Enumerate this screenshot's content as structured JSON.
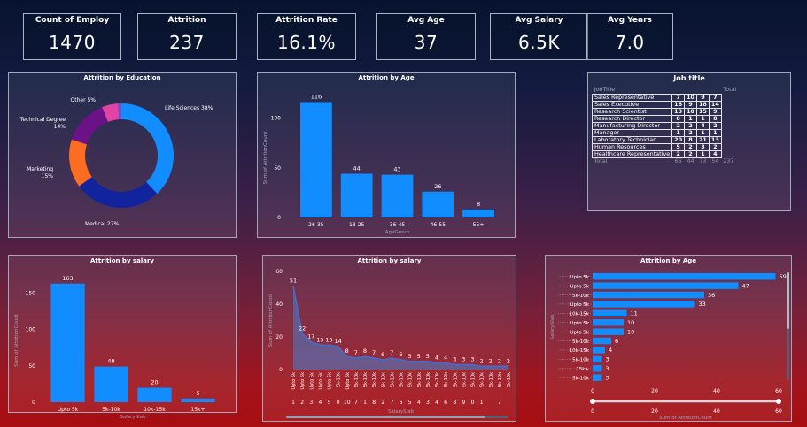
{
  "kpis": [
    {
      "title": "Count of Employ",
      "value": "1470"
    },
    {
      "title": "Attrition",
      "value": "237"
    },
    {
      "title": "Attrition Rate",
      "value": "16.1%"
    },
    {
      "title": "Avg Age",
      "value": "37"
    },
    {
      "title": "Avg Salary",
      "value": "6.5K"
    },
    {
      "title": "Avg Years",
      "value": "7.0"
    }
  ],
  "edu": {
    "title": "Attrition by Education",
    "slices": [
      {
        "label": "Life Sciences 38%",
        "value": 38,
        "color": "#118dff"
      },
      {
        "label": "Medical 27%",
        "value": 27,
        "color": "#12239e"
      },
      {
        "label": "Marketing 15%",
        "value": 15,
        "color": "#fc6c21"
      },
      {
        "label": "Technical Degree 14%",
        "value": 14,
        "color": "#6c1287"
      },
      {
        "label": "Other 5%",
        "value": 5,
        "color": "#e044a7"
      },
      {
        "label": "",
        "value": 1,
        "color": "#744ec2"
      }
    ]
  },
  "age_panel": {
    "title": "Attrition by Age",
    "ylabel": "Sum of AttritionCount",
    "xlabel": "AgeGroup"
  },
  "job": {
    "title": "Job title",
    "headers": [
      "JobTitle",
      "",
      "",
      "",
      "",
      "Total"
    ],
    "rows": [
      {
        "name": "Sales Representative",
        "vals": [
          "7",
          "10",
          "9",
          "7"
        ]
      },
      {
        "name": "Sales Executive",
        "vals": [
          "16",
          "9",
          "18",
          "14"
        ]
      },
      {
        "name": "Research Scientist",
        "vals": [
          "13",
          "10",
          "15",
          "9"
        ]
      },
      {
        "name": "Research Director",
        "vals": [
          "0",
          "1",
          "1",
          "0"
        ]
      },
      {
        "name": "Manufacturing Director",
        "vals": [
          "2",
          "2",
          "4",
          "2"
        ]
      },
      {
        "name": "Manager",
        "vals": [
          "1",
          "2",
          "1",
          "1"
        ]
      },
      {
        "name": "Laboratory Technician",
        "vals": [
          "20",
          "8",
          "21",
          "13"
        ]
      },
      {
        "name": "Human Resources",
        "vals": [
          "5",
          "2",
          "3",
          "2"
        ]
      },
      {
        "name": "Healthcare Representative",
        "vals": [
          "2",
          "2",
          "1",
          "4"
        ]
      }
    ],
    "total_row": {
      "name": "Total",
      "vals": [
        "66",
        "44",
        "73",
        "54"
      ],
      "total": "237"
    }
  },
  "salary_panel": {
    "title": "Attrition by salary",
    "ylabel": "Sum of AttritionCount",
    "xlabel": "SalarySlab"
  },
  "area_panel": {
    "title": "Attrition by salary",
    "ylabel": "Sum of AttritionCount",
    "xlabel": "SalarySlab"
  },
  "hbar_panel": {
    "title": "Attrition by Age",
    "ylabel": "SalarySlab",
    "xlabel": "Sum of AttritionCount"
  },
  "chart_data": [
    {
      "type": "bar",
      "title": "Attrition by Age",
      "xlabel": "AgeGroup",
      "ylabel": "Sum of AttritionCount",
      "categories": [
        "26-35",
        "18-25",
        "36-45",
        "46-55",
        "55+"
      ],
      "values": [
        116,
        44,
        43,
        26,
        8
      ],
      "ylim": [
        0,
        120
      ],
      "yticks": [
        0,
        50,
        100
      ],
      "color": "#118dff"
    },
    {
      "type": "bar",
      "title": "Attrition by salary",
      "xlabel": "SalarySlab",
      "ylabel": "Sum of AttritionCount",
      "categories": [
        "Upto 5k",
        "5k-10k",
        "10k-15k",
        "15k+"
      ],
      "values": [
        163,
        49,
        20,
        5
      ],
      "ylim": [
        0,
        170
      ],
      "yticks": [
        0,
        50,
        100,
        150
      ],
      "color": "#118dff"
    },
    {
      "type": "area",
      "title": "Attrition by salary",
      "xlabel": "SalarySlab",
      "ylabel": "Sum of AttritionCount",
      "categories": [
        "Upto 5k",
        "Upto 5k",
        "Upto 5k",
        "Upto 5k",
        "Upto 5k",
        "5k-10k",
        "Upto 5k",
        "5k-10k",
        "5k-10k",
        "5k-10k",
        "5k-10k",
        "5k-10k",
        "5k-10k",
        "5k-10k",
        "5k-10k",
        "5k-10k",
        "5k-10k",
        "5k-10k",
        "5k-10k",
        "5k-10k",
        "5k-10k",
        "5k-10k",
        "5k-10k",
        "5k-10k",
        "5k-10k"
      ],
      "index_labels": [
        "1",
        "2",
        "3",
        "4",
        "5",
        "0",
        "10",
        "7",
        "1",
        "8",
        "2",
        "7",
        "6",
        "5",
        "4",
        "3",
        "4",
        "6",
        "8",
        "9",
        "0",
        "1",
        "",
        "7",
        ""
      ],
      "values": [
        51,
        22,
        17,
        15,
        15,
        14,
        8,
        7,
        8,
        7,
        6,
        7,
        6,
        5,
        5,
        5,
        4,
        4,
        3,
        3,
        3,
        2,
        2,
        2,
        2
      ],
      "ylim": [
        0,
        60
      ],
      "yticks": [
        0,
        20,
        40,
        60
      ],
      "color": "#3d6fd8"
    },
    {
      "type": "hbar",
      "title": "Attrition by Age",
      "xlabel": "Sum of AttritionCount",
      "ylabel": "SalarySlab",
      "categories": [
        "Upto 5k",
        "Upto 5k",
        "5k-10k",
        "Upto 5k",
        "10k-15k",
        "Upto 5k",
        "Upto 5k",
        "5k-10k",
        "10k-15k",
        "5k-10k",
        "15k+",
        "5k-10k"
      ],
      "values": [
        59,
        47,
        36,
        33,
        11,
        10,
        10,
        6,
        4,
        3,
        3,
        3
      ],
      "xlim": [
        0,
        60
      ],
      "xticks": [
        0,
        20,
        40,
        60
      ],
      "color": "#118dff"
    }
  ]
}
